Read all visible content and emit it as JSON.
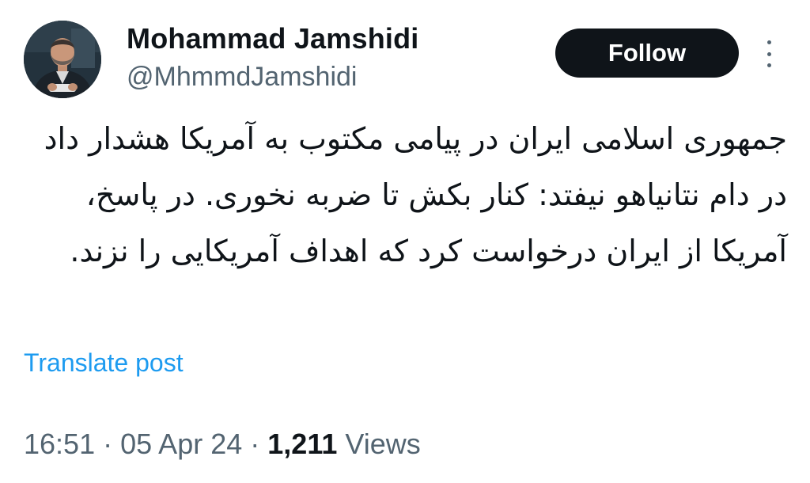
{
  "author": {
    "display_name": "Mohammad Jamshidi",
    "handle": "@MhmmdJamshidi",
    "avatar_icon": "profile-photo"
  },
  "actions": {
    "follow_label": "Follow",
    "more_icon": "vertical-ellipsis-icon"
  },
  "post": {
    "text": "جمهوری اسلامی ایران در پیامی مکتوب به آمریکا هشدار داد در دام نتانیاهو نیفتد: کنار بکش تا ضربه نخوری. در پاسخ، آمریکا از ایران درخواست کرد که اهداف آمریکایی را نزند.",
    "translate_label": "Translate post"
  },
  "meta": {
    "time": "16:51",
    "separator": "·",
    "date": "05 Apr 24",
    "views_count": "1,211",
    "views_label": "Views"
  },
  "colors": {
    "text_primary": "#0f1419",
    "text_secondary": "#536471",
    "link": "#1d9bf0",
    "button_bg": "#0f1419",
    "button_text": "#ffffff",
    "background": "#ffffff"
  }
}
